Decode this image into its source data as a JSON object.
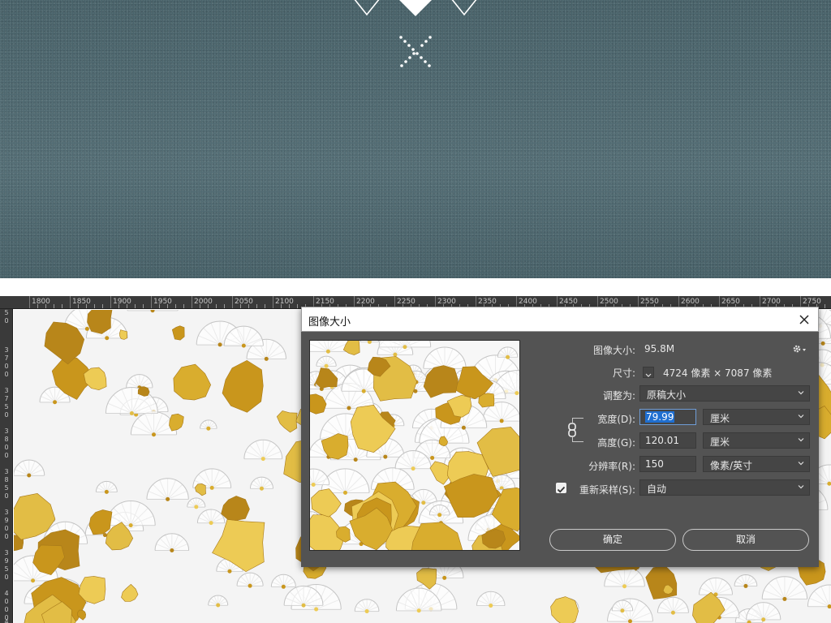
{
  "dialog": {
    "title": "图像大小",
    "image_size_label": "图像大小:",
    "image_size_value": "95.8M",
    "dimensions_label": "尺寸:",
    "dimensions_value": "4724 像素 × 7087 像素",
    "fit_to_label": "调整为:",
    "fit_to_value": "原稿大小",
    "width_label": "宽度(D):",
    "width_value": "79.99",
    "width_unit": "厘米",
    "height_label": "高度(G):",
    "height_value": "120.01",
    "height_unit": "厘米",
    "resolution_label": "分辨率(R):",
    "resolution_value": "150",
    "resolution_unit": "像素/英寸",
    "resample_label": "重新采样(S):",
    "resample_checked": true,
    "resample_value": "自动",
    "ok_label": "确定",
    "cancel_label": "取消"
  },
  "ruler": {
    "top_labels": [
      "1800",
      "1850",
      "1900",
      "1950",
      "2000",
      "2050",
      "2100",
      "2150",
      "2200",
      "2250",
      "2300",
      "2350",
      "2400",
      "2450",
      "2500",
      "2550",
      "2600",
      "2650",
      "2700",
      "2750"
    ],
    "left_labels": [
      [
        "5",
        "0"
      ],
      [
        "3",
        "7",
        "0",
        "0"
      ],
      [
        "3",
        "7",
        "5",
        "0"
      ],
      [
        "3",
        "8",
        "0",
        "0"
      ],
      [
        "3",
        "8",
        "5",
        "0"
      ],
      [
        "3",
        "9",
        "0",
        "0"
      ],
      [
        "3",
        "9",
        "5",
        "0"
      ],
      [
        "4",
        "0",
        "0",
        "0"
      ],
      [
        "4"
      ]
    ]
  },
  "colors": {
    "banner": "#4d6870",
    "dialog_bg": "#535353",
    "gold": "#d4a62a",
    "selection": "#1f6fd1"
  },
  "icons": {
    "banner_ornament": "diamond-x-ornament-icon",
    "close": "close-icon",
    "gear": "gear-icon",
    "link": "chain-link-icon",
    "checkbox": "checkmark-icon",
    "dropdown": "chevron-down-icon"
  }
}
